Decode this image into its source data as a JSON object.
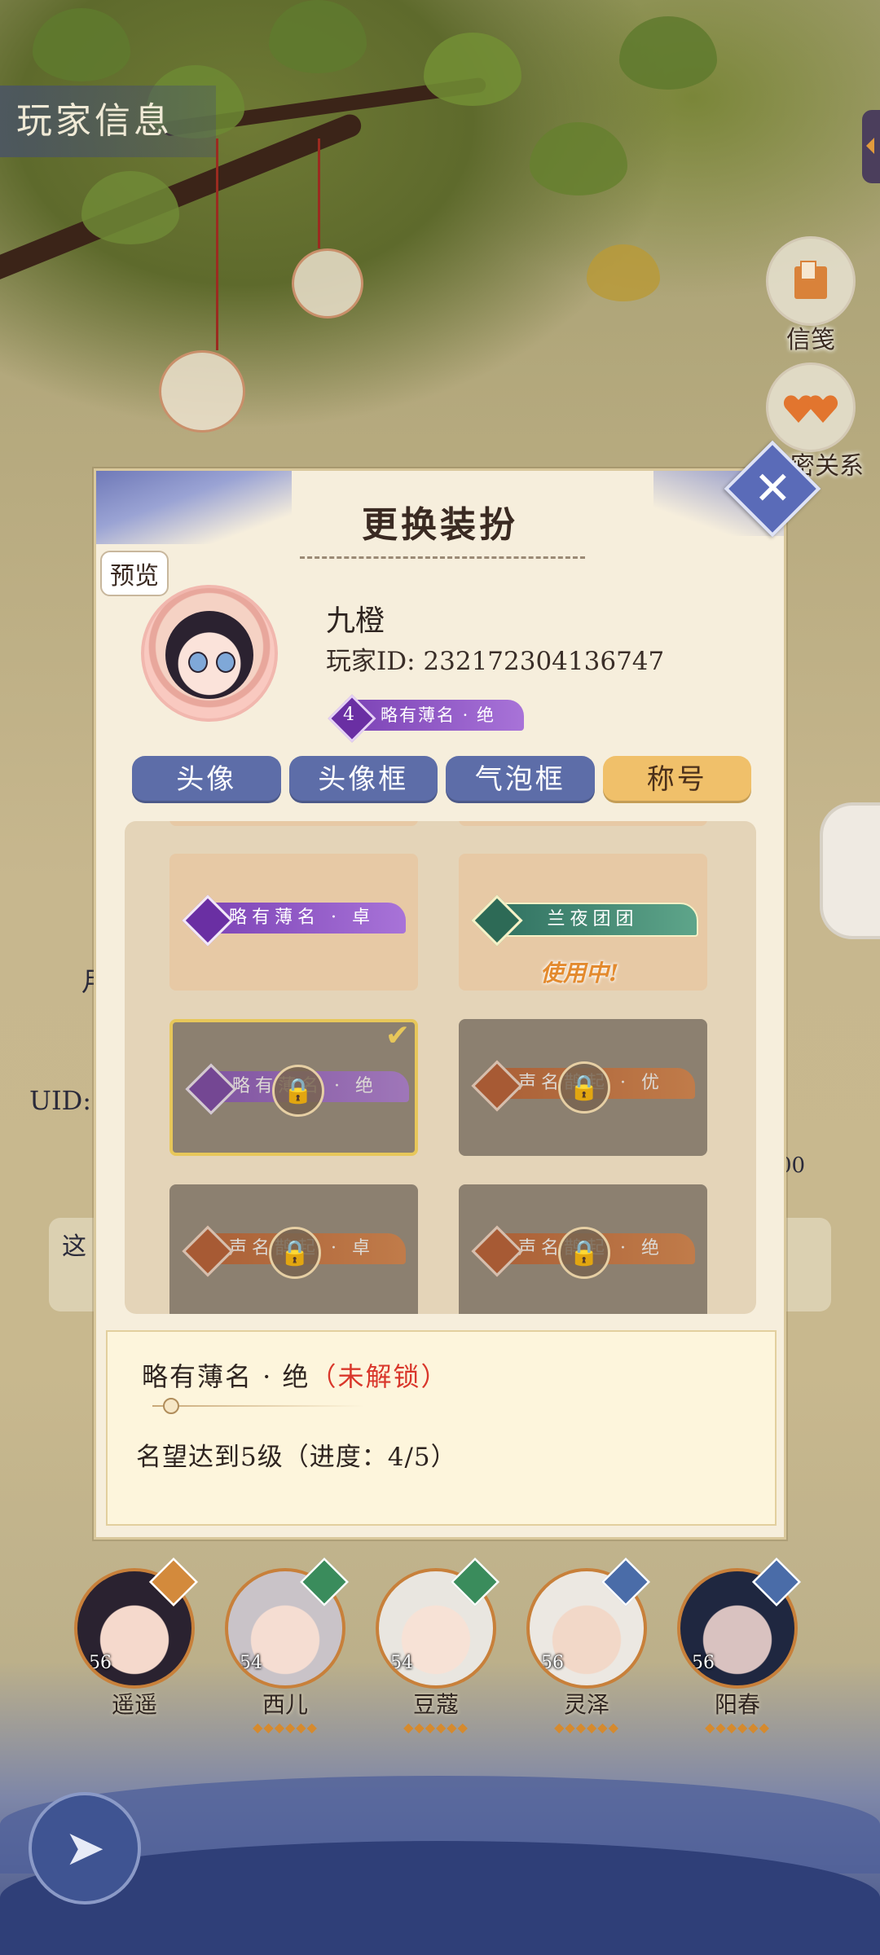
{
  "screen_title": "玩家信息",
  "side_buttons": [
    {
      "label": "信笺",
      "icon": "letter-icon"
    },
    {
      "label": "亲密关系",
      "icon": "hearts-icon"
    }
  ],
  "under_page": {
    "uid_label": "UID:",
    "partial_1": "这",
    "partial_2": "月",
    "count_suffix": "00"
  },
  "modal": {
    "title": "更换装扮",
    "preview_label": "预览",
    "player_name": "九橙",
    "player_id": "玩家ID: 232172304136747",
    "current_title": {
      "level": "4",
      "text": "略有薄名 · 绝"
    },
    "tabs": [
      "头像",
      "头像框",
      "气泡框",
      "称号"
    ],
    "active_tab": "称号",
    "titles": [
      {
        "text": "略有薄名 · 卓",
        "style": "purple",
        "locked": false
      },
      {
        "text": "兰夜团团",
        "style": "green",
        "locked": false,
        "in_use_label": "使用中!"
      },
      {
        "text": "略有薄名 · 绝",
        "style": "purple",
        "locked": true,
        "selected": true
      },
      {
        "text": "声名鹊起 · 优",
        "style": "orange",
        "locked": true
      },
      {
        "text": "声名鹊起 · 卓",
        "style": "orange",
        "locked": true
      },
      {
        "text": "声名鹊起 · 绝",
        "style": "orange",
        "locked": true
      }
    ],
    "detail": {
      "name": "略有薄名 · 绝",
      "status": "（未解锁）",
      "requirement": "名望达到5级（进度：4/5）"
    }
  },
  "characters": [
    {
      "name": "遥遥",
      "level": "56",
      "color": "#d38a3c"
    },
    {
      "name": "西儿",
      "level": "54",
      "color": "#3a8c5c"
    },
    {
      "name": "豆蔻",
      "level": "54",
      "color": "#3a8c5c"
    },
    {
      "name": "灵泽",
      "level": "56",
      "color": "#4a6ca8"
    },
    {
      "name": "阳春",
      "level": "56",
      "color": "#4a6ca8"
    }
  ],
  "colors": {
    "accent": "#5d6da8",
    "active_tab": "#f0c06a",
    "locked_red": "#d9372b"
  }
}
